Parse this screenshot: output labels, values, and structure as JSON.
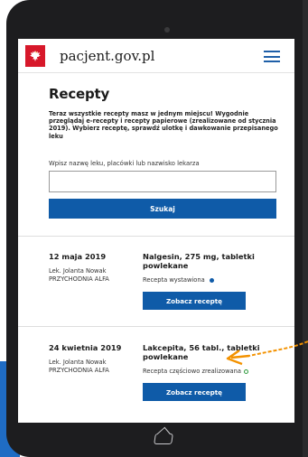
{
  "header": {
    "site_title": "pacjent.gov.pl",
    "logo_icon": "polish-eagle-emblem",
    "menu_icon": "hamburger-menu-icon"
  },
  "main": {
    "title": "Recepty",
    "intro": "Teraz wszystkie recepty masz w jednym miejscu! Wygodnie przeglądaj e-recepty i recepty papierowe (zrealizowane od stycznia 2019). Wybierz receptę, sprawdź ulotkę i dawkowanie przepisanego leku",
    "search": {
      "label": "Wpisz nazwę leku, placówki lub nazwisko lekarza",
      "value": "",
      "button_label": "Szukaj"
    }
  },
  "prescriptions": [
    {
      "date": "12 maja 2019",
      "doctor": "Lek. Jolanta Nowak",
      "clinic": "PRZYCHODNIA ALFA",
      "drug": "Nalgesin, 275 mg, tabletki powlekane",
      "status": "Recepta wystawiona",
      "status_icon": "filled-dot-icon",
      "button_label": "Zobacz receptę"
    },
    {
      "date": "24 kwietnia 2019",
      "doctor": "Lek. Jolanta Nowak",
      "clinic": "PRZYCHODNIA ALFA",
      "drug": "Lakcepita, 56 tabl., tabletki powlekane",
      "status": "Recepta częściowo zrealizowana",
      "status_icon": "empty-dot-icon",
      "button_label": "Zobacz receptę"
    }
  ],
  "colors": {
    "primary": "#0f5ba8",
    "logo_red": "#d7182a",
    "status_issued": "#0f5ba8",
    "status_partial": "#2e9a3d",
    "annotation_arrow": "#f39200"
  }
}
